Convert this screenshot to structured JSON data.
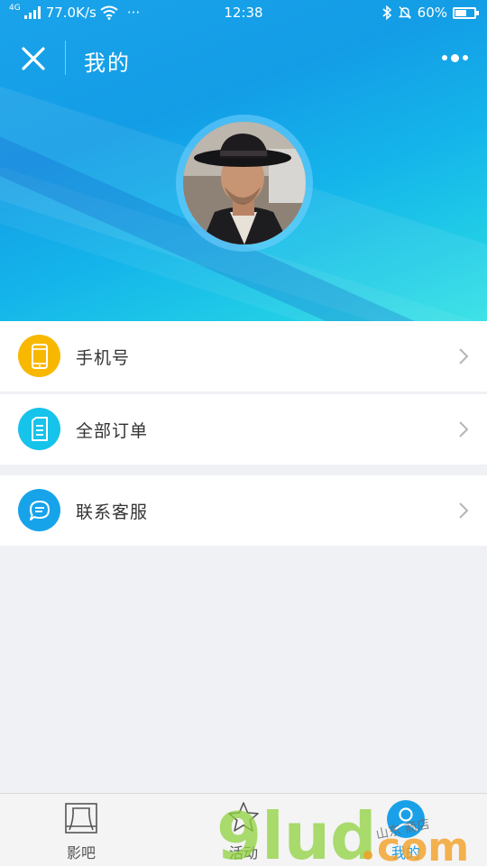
{
  "status_bar": {
    "network_type": "4G",
    "speed": "77.0K/s",
    "more": "···",
    "time": "12:38",
    "battery": "60%",
    "battery_level": 0.6
  },
  "header": {
    "title": "我的"
  },
  "menu": [
    {
      "label": "手机号",
      "icon": "phone-icon",
      "icon_color": "#f8b800"
    },
    {
      "label": "全部订单",
      "icon": "order-document-icon",
      "icon_color": "#16c3ea"
    },
    {
      "label": "联系客服",
      "icon": "customer-service-chat-icon",
      "icon_color": "#17a3ea"
    }
  ],
  "tabbar": {
    "tabs": [
      {
        "label": "影吧",
        "icon": "cinema-screen-icon"
      },
      {
        "label": "活动",
        "icon": "star-icon"
      },
      {
        "label": "我的",
        "icon": "user-profile-icon",
        "active": true
      }
    ]
  },
  "colors": {
    "accent": "#1aa0e8",
    "background": "#eff1f4"
  },
  "watermark": {
    "text": "9lud.com",
    "sub": "山东商店"
  }
}
